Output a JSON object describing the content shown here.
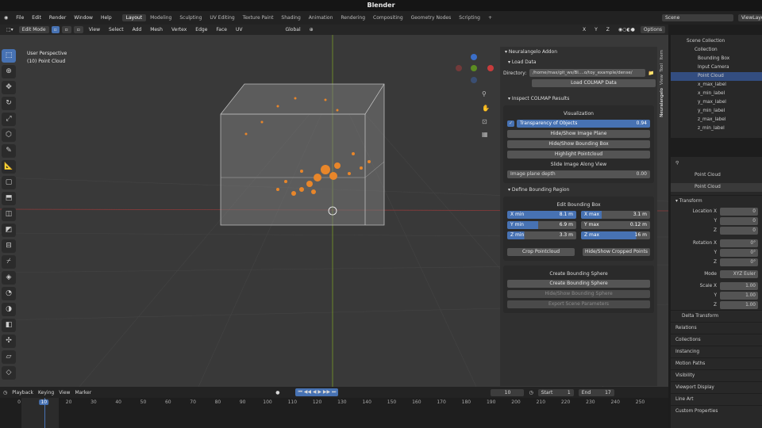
{
  "app": {
    "title": "Blender"
  },
  "menu": [
    "File",
    "Edit",
    "Render",
    "Window",
    "Help"
  ],
  "workspaces": [
    {
      "label": "Layout",
      "active": true
    },
    {
      "label": "Modeling"
    },
    {
      "label": "Sculpting"
    },
    {
      "label": "UV Editing"
    },
    {
      "label": "Texture Paint"
    },
    {
      "label": "Shading"
    },
    {
      "label": "Animation"
    },
    {
      "label": "Rendering"
    },
    {
      "label": "Compositing"
    },
    {
      "label": "Geometry Nodes"
    },
    {
      "label": "Scripting"
    },
    {
      "label": "+"
    }
  ],
  "top_right": {
    "scene": "Scene",
    "viewlayer": "ViewLayer"
  },
  "header": {
    "mode": "Edit Mode",
    "items": [
      "View",
      "Select",
      "Add",
      "Mesh",
      "Vertex",
      "Edge",
      "Face",
      "UV"
    ],
    "orientation": "Global",
    "axes": [
      "X",
      "Y",
      "Z"
    ],
    "options": "Options"
  },
  "viewport": {
    "view_name": "User Perspective",
    "object": "(10) Point Cloud"
  },
  "ntabs": [
    "Item",
    "Tool",
    "View",
    "Neuralangelo"
  ],
  "addon": {
    "title": "Neuralangelo Addon",
    "load_data": {
      "title": "Load Data",
      "dir_label": "Directory:",
      "dir_value": "/home/max/git_ws/Bl....o/toy_example/dense/",
      "load_button": "Load COLMAP Data"
    },
    "inspect": {
      "title": "Inspect COLMAP Results",
      "vis_label": "Visualization",
      "transparency_label": "Transparency of Objects",
      "transparency_value": "0.94",
      "transparency_fraction": 0.94,
      "btn_image_plane": "Hide/Show Image Plane",
      "btn_bbox": "Hide/Show Bounding Box",
      "btn_highlight": "Highlight Pointcloud",
      "slide_label": "Slide Image Along View",
      "depth_label": "Image plane depth",
      "depth_value": "0.00"
    },
    "define_bbox": {
      "title": "Define Bounding Region",
      "edit_label": "Edit Bounding Box",
      "fields": [
        {
          "label": "X min",
          "value": "8.1 m"
        },
        {
          "label": "X max",
          "value": "3.1 m"
        },
        {
          "label": "Y min",
          "value": "6.9 m"
        },
        {
          "label": "Y max",
          "value": "0.12 m"
        },
        {
          "label": "Z min",
          "value": "3.3 m"
        },
        {
          "label": "Z max",
          "value": "16 m"
        }
      ],
      "btn_crop": "Crop Pointcloud",
      "btn_hide_cropped": "Hide/Show Cropped Points"
    },
    "sphere": {
      "label": "Create Bounding Sphere",
      "btn_create": "Create Bounding Sphere",
      "btn_hide": "Hide/Show Bounding Sphere",
      "btn_export": "Export Scene Parameters"
    }
  },
  "outliner": {
    "search": "",
    "root": "Scene Collection",
    "items": [
      "Collection",
      "Bounding Box",
      "Input Camera",
      "Point Cloud",
      "x_max_label",
      "x_min_label",
      "y_max_label",
      "y_min_label",
      "z_max_label",
      "z_min_label"
    ]
  },
  "properties": {
    "object_name": "Point Cloud",
    "data_name": "Point Cloud",
    "transform": "Transform",
    "rows": [
      {
        "k": "Location X",
        "v": "0"
      },
      {
        "k": "Y",
        "v": "0"
      },
      {
        "k": "Z",
        "v": "0"
      },
      {
        "k": "Rotation X",
        "v": "0°"
      },
      {
        "k": "Y",
        "v": "0°"
      },
      {
        "k": "Z",
        "v": "0°"
      },
      {
        "k": "Mode",
        "v": "XYZ Euler"
      },
      {
        "k": "Scale X",
        "v": "1.00"
      },
      {
        "k": "Y",
        "v": "1.00"
      },
      {
        "k": "Z",
        "v": "1.00"
      }
    ],
    "sections": [
      "Delta Transform",
      "Relations",
      "Collections",
      "Instancing",
      "Motion Paths",
      "Visibility",
      "Viewport Display",
      "Line Art",
      "Custom Properties"
    ]
  },
  "timeline": {
    "menus": [
      "Playback",
      "Keying",
      "View",
      "Marker"
    ],
    "current": "10",
    "start_label": "Start",
    "start": "1",
    "end_label": "End",
    "end": "17",
    "ticks": [
      "0",
      "10",
      "20",
      "30",
      "40",
      "50",
      "60",
      "70",
      "80",
      "90",
      "100",
      "110",
      "120",
      "130",
      "140",
      "150",
      "160",
      "170",
      "180",
      "190",
      "200",
      "210",
      "220",
      "230",
      "240",
      "250"
    ]
  },
  "colors": {
    "accent": "#4772b3",
    "points": "#e8862a"
  }
}
